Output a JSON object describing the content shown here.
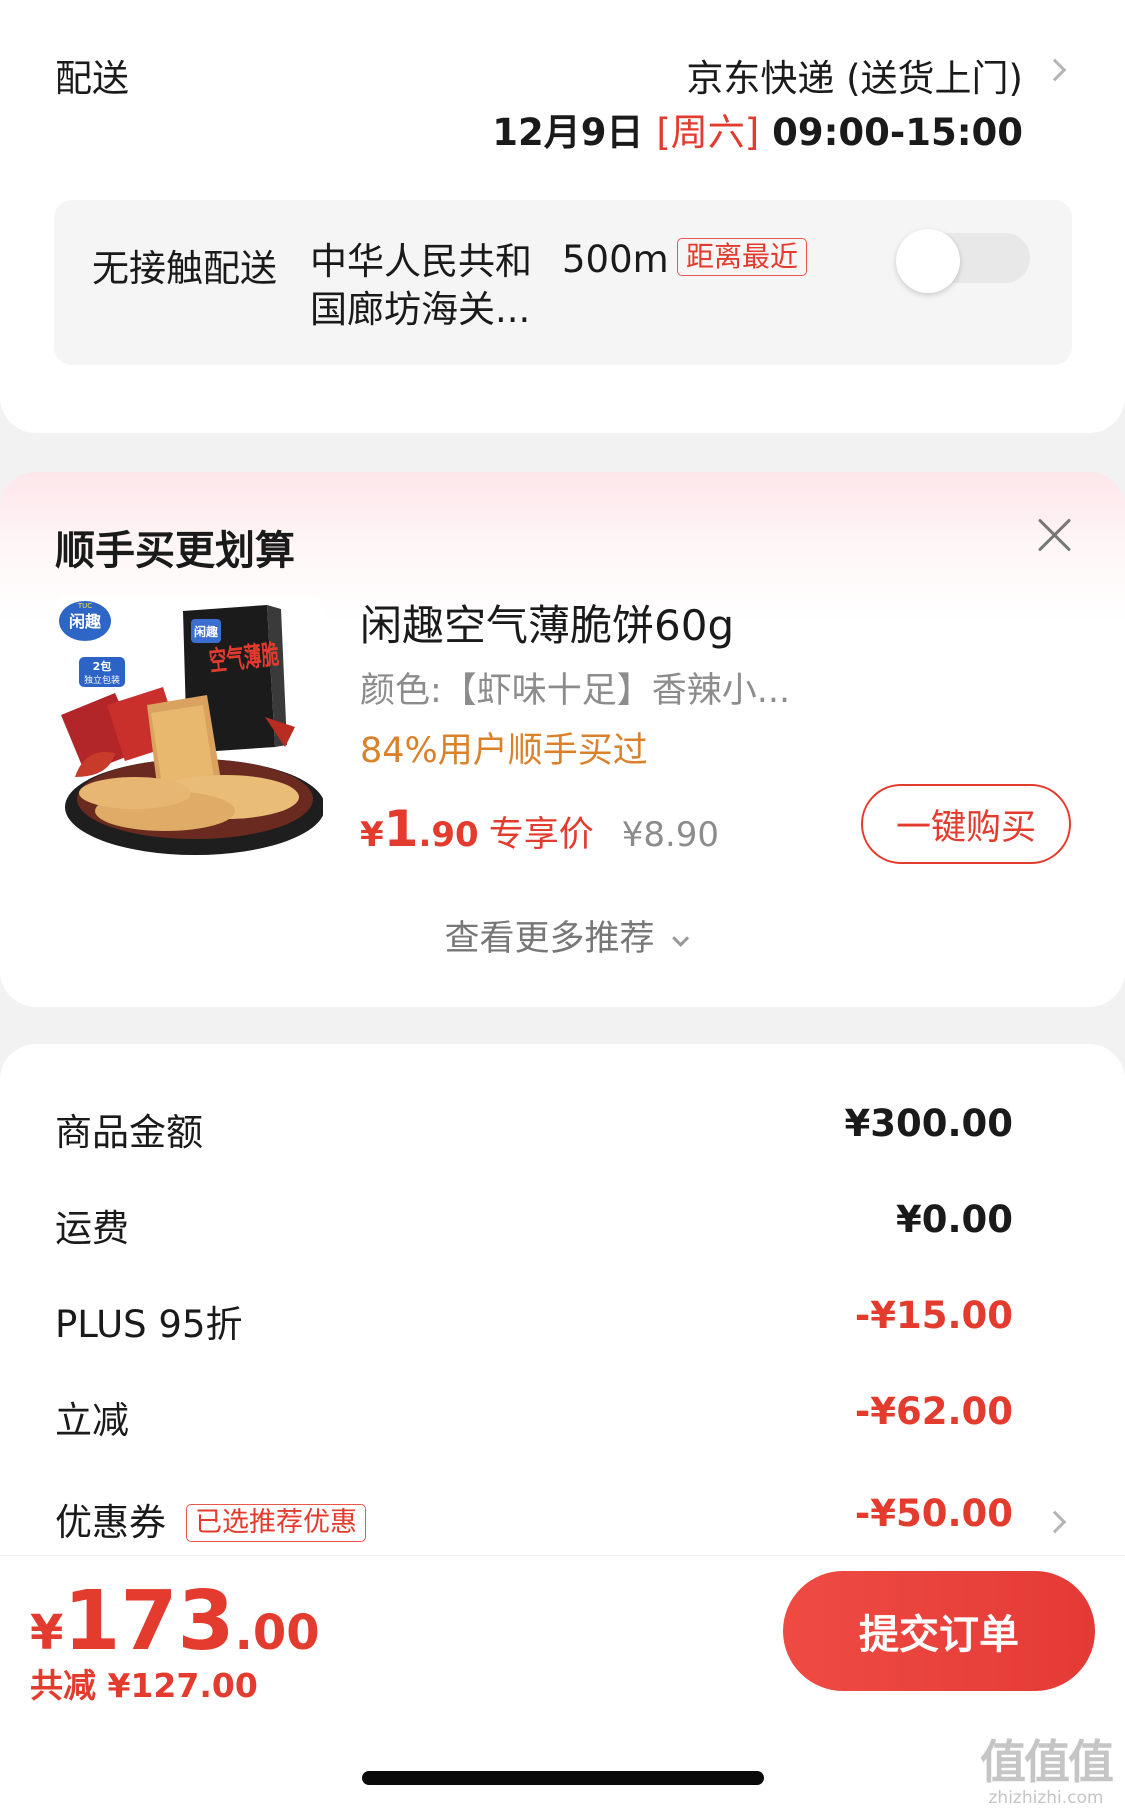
{
  "delivery": {
    "label": "配送",
    "method": "京东快递 (送货上门)",
    "date": "12月9日 ",
    "weekday": "[周六]",
    "time_range": " 09:00-15:00",
    "contactless": {
      "title": "无接触配送",
      "address": "中华人民共和国廊坊海关...",
      "distance": "500m",
      "badge": "距离最近",
      "enabled": false
    }
  },
  "recommend": {
    "title": "顺手买更划算",
    "product": {
      "name": "闲趣空气薄脆饼60g",
      "spec": "颜色:【虾味十足】香辣小...",
      "stat": "84%用户顺手买过",
      "price_symbol": "¥",
      "price_int": "1",
      "price_dec": ".90",
      "price_tag": "专享价",
      "original_price": "¥8.90",
      "buy_label": "一键购买",
      "image_text": {
        "brand": "闲趣",
        "brand_small": "TUC",
        "box_title": "空气薄脆",
        "pack_note_1": "2包",
        "pack_note_2": "独立包装"
      }
    },
    "more_label": "查看更多推荐"
  },
  "summary": {
    "rows": [
      {
        "label": "商品金额",
        "value": "¥300.00"
      },
      {
        "label": "运费",
        "value": "¥0.00"
      },
      {
        "label": "PLUS 95折",
        "value": "-¥15.00"
      },
      {
        "label": "立减",
        "value": "-¥62.00"
      },
      {
        "label": "优惠券",
        "value": "-¥50.00",
        "badge": "已选推荐优惠"
      }
    ]
  },
  "footer": {
    "total_symbol": "¥",
    "total_int": "173",
    "total_dec": ".00",
    "saving": "共减 ¥127.00",
    "submit_label": "提交订单"
  },
  "watermark": {
    "logo": "值值值",
    "url": "zhizhizhi.com"
  },
  "colors": {
    "accent_red": "#e33b2e",
    "accent_orange": "#d9822b",
    "background": "#f2f2f2"
  }
}
